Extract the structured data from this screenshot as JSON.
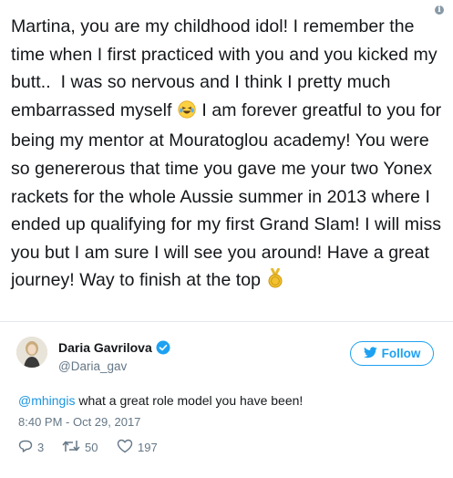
{
  "quoted_tweet": {
    "text_part1": "Martina, you are my childhood idol! I remember the time when I first practiced with you and you kicked my butt..  I was so nervous and I think I pretty much embarrassed myself ",
    "emoji1": "laughing-with-tears-emoji",
    "text_part2": " I am forever greatful to you for being my mentor at Mouratoglou academy! You were so genererous that time you gave me your two Yonex rackets for the whole Aussie summer in 2013 where I ended up qualifying for my first Grand Slam! I will miss you but I am sure I will see you around! Have a great journey! Way to finish at the top ",
    "emoji2": "gold-medal-emoji"
  },
  "author": {
    "name": "Daria Gavrilova",
    "handle": "@Daria_gav",
    "verified": true
  },
  "follow_button": {
    "label": "Follow",
    "icon": "twitter-bird-icon"
  },
  "reply": {
    "mention": "@mhingis",
    "text": " what a great role model you have been!"
  },
  "timestamp": "8:40 PM - Oct 29, 2017",
  "stats": {
    "replies": "3",
    "retweets": "50",
    "likes": "197"
  },
  "colors": {
    "accent": "#1da1f2",
    "mention": "#1b95e0",
    "muted": "#657786",
    "text": "#14171a",
    "divider": "#e1e8ed"
  }
}
